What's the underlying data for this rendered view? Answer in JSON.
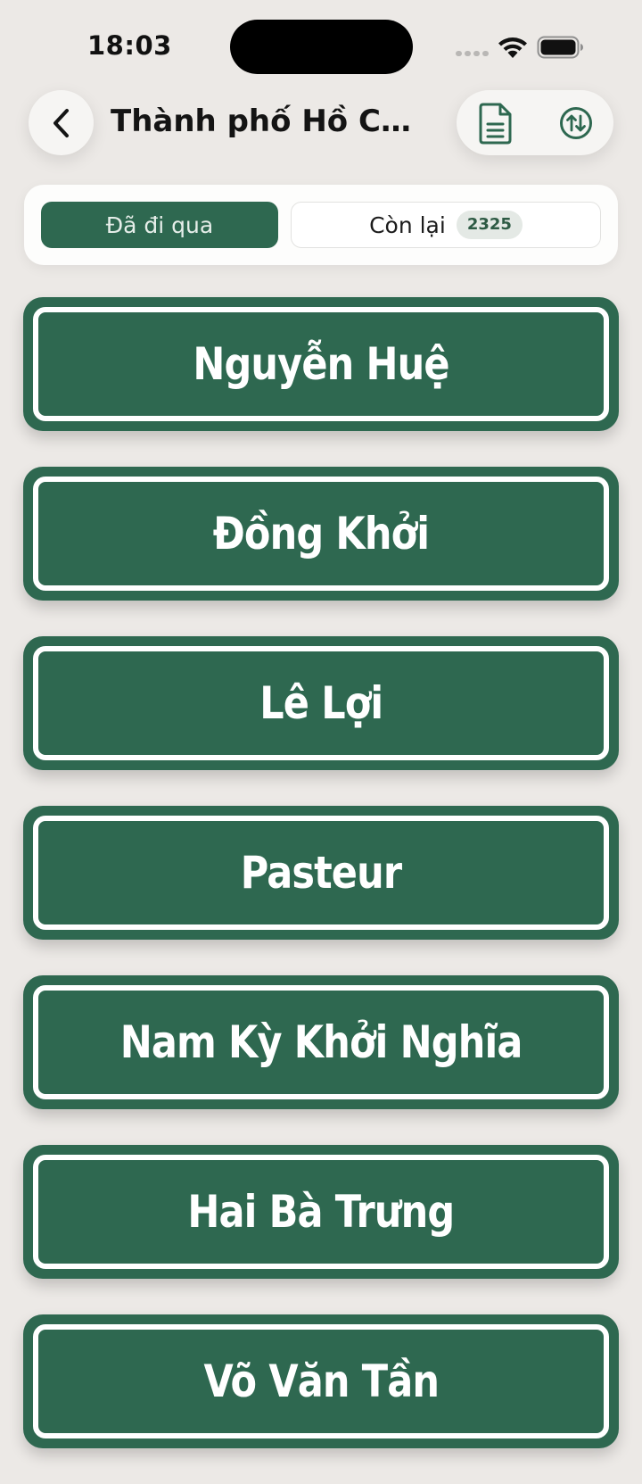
{
  "status_bar": {
    "time": "18:03"
  },
  "header": {
    "title": "Thành phố Hồ Chí...",
    "icons": {
      "back": "chevron-left-icon",
      "document": "document-icon",
      "sort": "sort-arrows-icon"
    }
  },
  "segments": {
    "visited_label": "Đã đi qua",
    "remaining_label": "Còn lại",
    "remaining_count": "2325"
  },
  "colors": {
    "accent": "#2e6850",
    "background": "#ece9e6"
  },
  "streets": [
    {
      "name": "Nguyễn Huệ"
    },
    {
      "name": "Đồng Khởi"
    },
    {
      "name": "Lê Lợi"
    },
    {
      "name": "Pasteur"
    },
    {
      "name": "Nam Kỳ Khởi Nghĩa"
    },
    {
      "name": "Hai Bà Trưng"
    },
    {
      "name": "Võ Văn Tần"
    }
  ]
}
